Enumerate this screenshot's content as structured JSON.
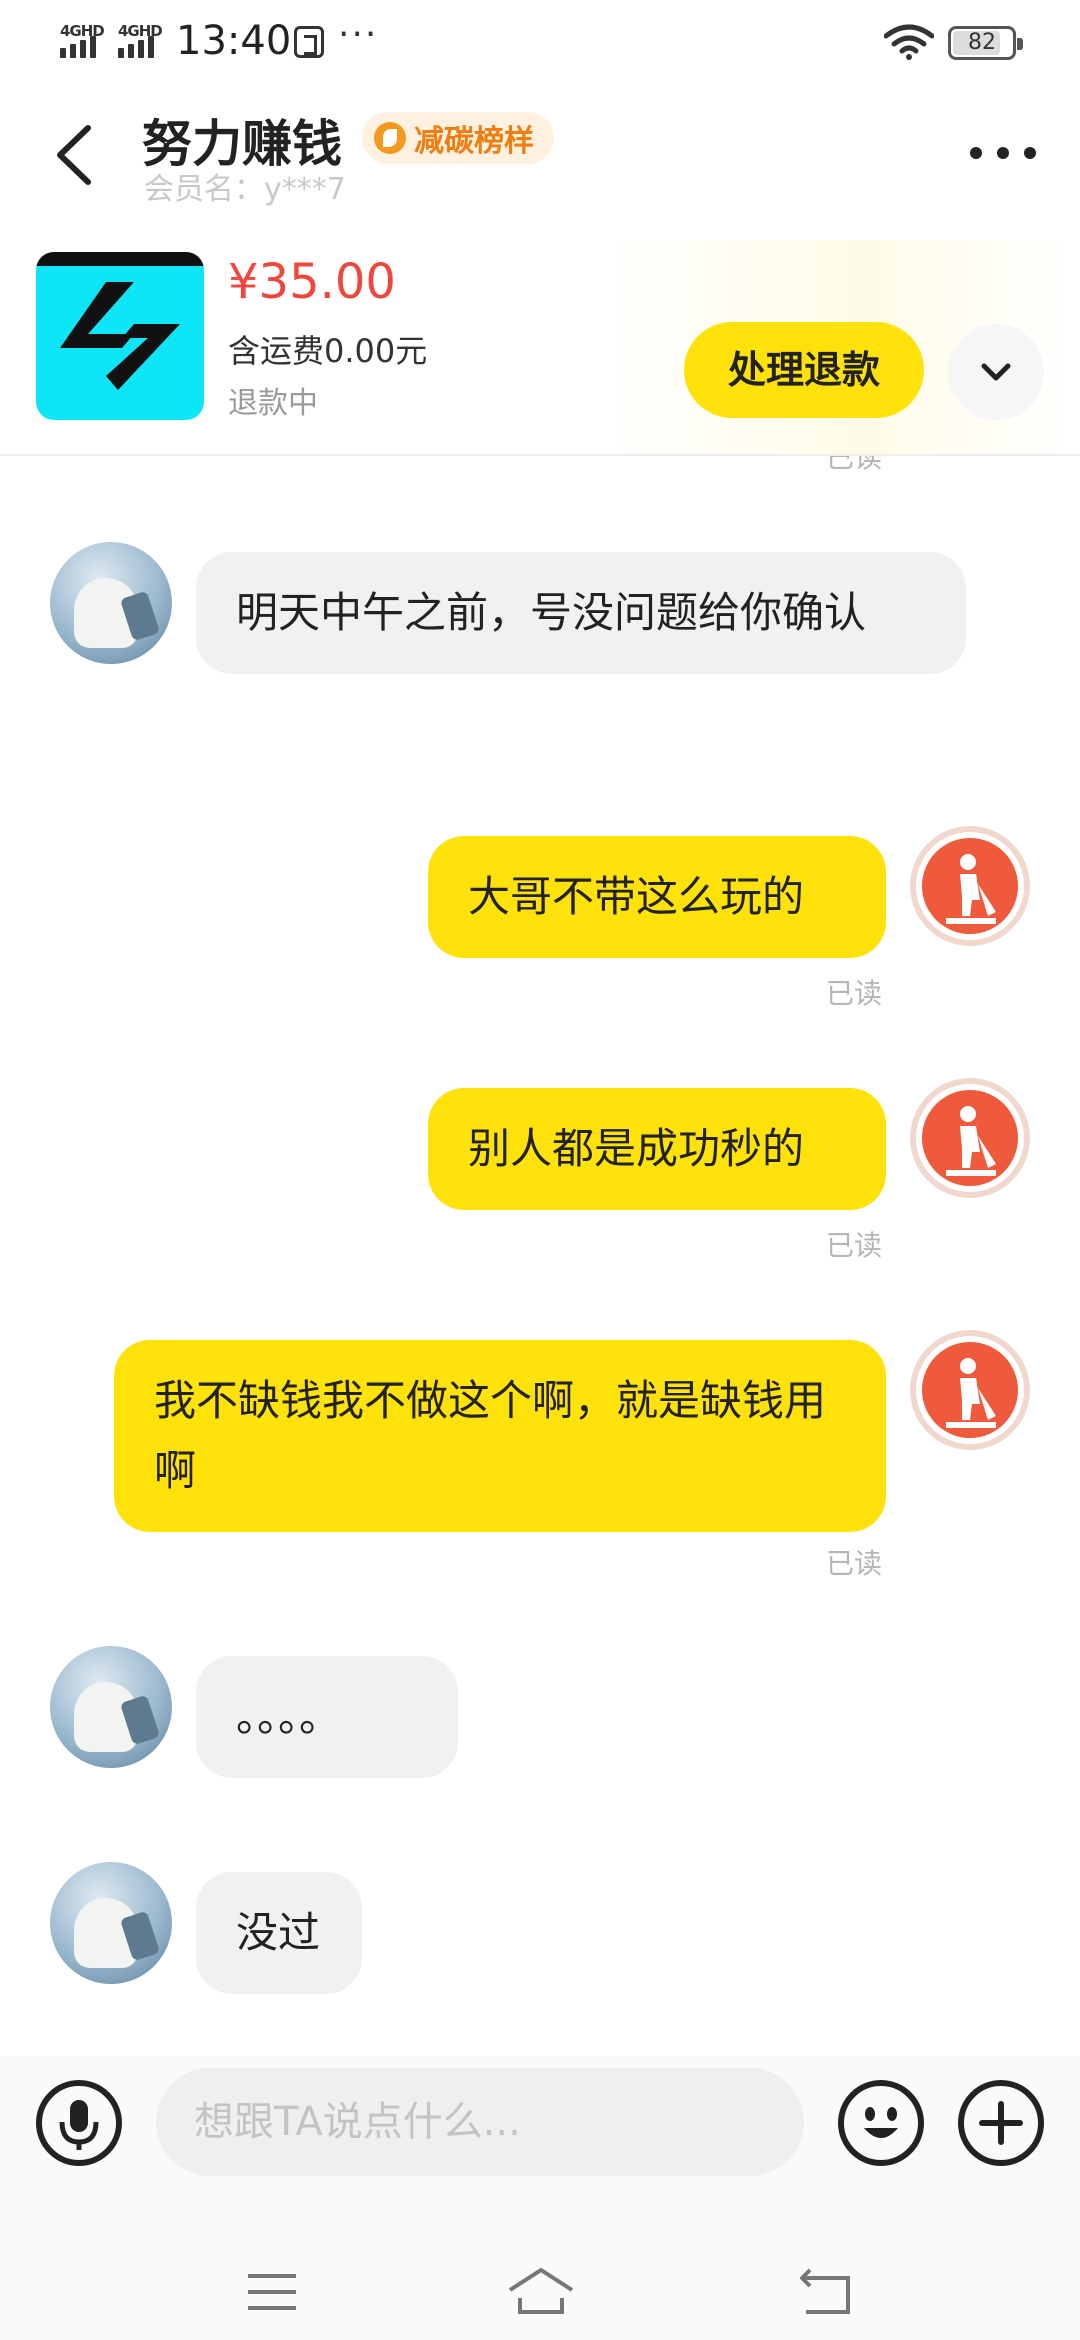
{
  "status_bar": {
    "signal1": "4GHD",
    "signal2": "4GHD",
    "time": "13:40",
    "more": "···",
    "battery": "82",
    "battery_level_percent": 82
  },
  "header": {
    "title": "努力赚钱",
    "badge": "减碳榜样",
    "member_label": "会员名：y***7"
  },
  "product": {
    "price": "¥35.00",
    "shipping": "含运费0.00元",
    "status": "退款中",
    "action_label": "处理退款"
  },
  "chat": {
    "partial_read": "已读",
    "messages": [
      {
        "side": "left",
        "text": "明天中午之前，号没问题给你确认"
      },
      {
        "side": "right",
        "text": "大哥不带这么玩的",
        "status": "已读"
      },
      {
        "side": "right",
        "text": "别人都是成功秒的",
        "status": "已读"
      },
      {
        "side": "right",
        "text": "我不缺钱我不做这个啊，就是缺钱用啊",
        "status": "已读"
      },
      {
        "side": "left",
        "text": "。。。。"
      },
      {
        "side": "left",
        "text": "没过"
      }
    ]
  },
  "input": {
    "placeholder": "想跟TA说点什么..."
  },
  "icons": {
    "back": "back-arrow-icon",
    "more": "more-dots-icon",
    "badge": "leaf-badge-icon",
    "expand": "chevron-down-icon",
    "voice": "microphone-icon",
    "emoji": "smiley-icon",
    "add": "plus-icon",
    "nav_menu": "menu-icon",
    "nav_home": "home-icon",
    "nav_back": "return-icon"
  },
  "colors": {
    "accent_yellow": "#ffe20a",
    "price_red": "#f0463c",
    "badge_orange": "#ef7d10",
    "bubble_gray": "#f1f1f3"
  }
}
